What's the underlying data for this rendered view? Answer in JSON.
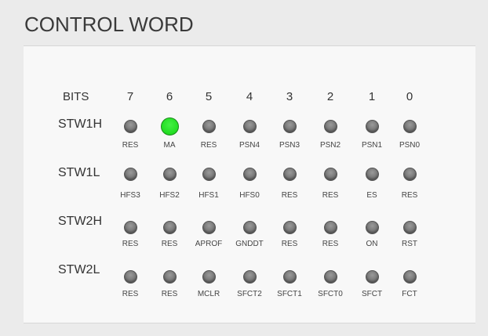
{
  "title": "CONTROL WORD",
  "bits_label": "BITS",
  "bit_numbers": [
    "7",
    "6",
    "5",
    "4",
    "3",
    "2",
    "1",
    "0"
  ],
  "rows": [
    {
      "label": "STW1H",
      "bits": [
        {
          "name": "RES",
          "on": false
        },
        {
          "name": "MA",
          "on": true
        },
        {
          "name": "RES",
          "on": false
        },
        {
          "name": "PSN4",
          "on": false
        },
        {
          "name": "PSN3",
          "on": false
        },
        {
          "name": "PSN2",
          "on": false
        },
        {
          "name": "PSN1",
          "on": false
        },
        {
          "name": "PSN0",
          "on": false
        }
      ]
    },
    {
      "label": "STW1L",
      "bits": [
        {
          "name": "HFS3",
          "on": false
        },
        {
          "name": "HFS2",
          "on": false
        },
        {
          "name": "HFS1",
          "on": false
        },
        {
          "name": "HFS0",
          "on": false
        },
        {
          "name": "RES",
          "on": false
        },
        {
          "name": "RES",
          "on": false
        },
        {
          "name": "ES",
          "on": false
        },
        {
          "name": "RES",
          "on": false
        }
      ]
    },
    {
      "label": "STW2H",
      "bits": [
        {
          "name": "RES",
          "on": false
        },
        {
          "name": "RES",
          "on": false
        },
        {
          "name": "APROF",
          "on": false
        },
        {
          "name": "GNDDT",
          "on": false
        },
        {
          "name": "RES",
          "on": false
        },
        {
          "name": "RES",
          "on": false
        },
        {
          "name": "ON",
          "on": false
        },
        {
          "name": "RST",
          "on": false
        }
      ]
    },
    {
      "label": "STW2L",
      "bits": [
        {
          "name": "RES",
          "on": false
        },
        {
          "name": "RES",
          "on": false
        },
        {
          "name": "MCLR",
          "on": false
        },
        {
          "name": "SFCT2",
          "on": false
        },
        {
          "name": "SFCT1",
          "on": false
        },
        {
          "name": "SFCT0",
          "on": false
        },
        {
          "name": "SFCT",
          "on": false
        },
        {
          "name": "FCT",
          "on": false
        }
      ]
    }
  ],
  "colors": {
    "led_on": "#22dd22",
    "led_off": "#777777"
  }
}
